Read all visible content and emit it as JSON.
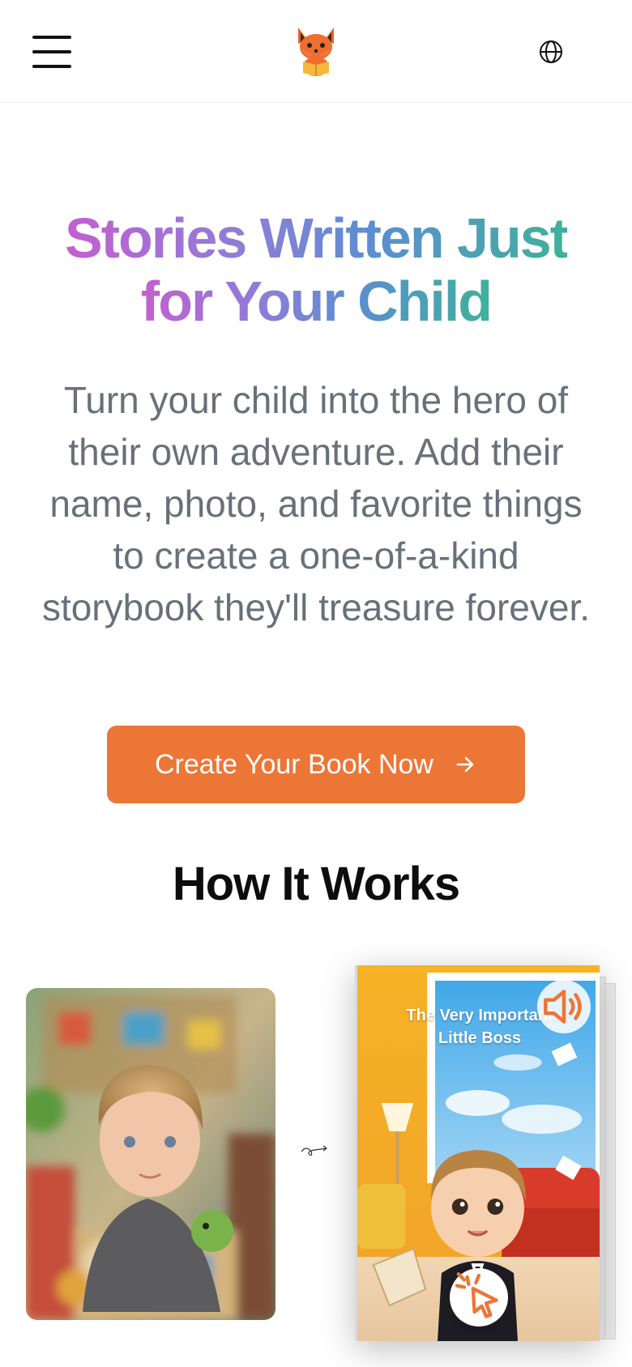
{
  "header": {
    "menu_icon": "hamburger-menu-icon",
    "logo_icon": "fox-reading-book-logo",
    "language_icon": "globe-icon"
  },
  "hero": {
    "title_line1": "Stories Written Just",
    "title_line2": "for Your Child",
    "subtitle": "Turn your child into the hero of their own adventure. Add their name, photo, and favorite things to create a one-of-a-kind storybook they'll treasure forever.",
    "cta_label": "Create Your Book Now",
    "cta_icon": "arrow-right-icon",
    "cta_color": "#ec7636"
  },
  "how_it_works": {
    "heading": "How It Works",
    "photo_icon": "child-photo",
    "arrow_icon": "curly-arrow-icon",
    "book": {
      "title": "The Very Important Little Boss",
      "audio_icon": "speaker-icon",
      "tap_icon": "tap-pointer-icon"
    }
  },
  "colors": {
    "gradient": [
      "#c45fd0",
      "#8d7ed8",
      "#5a8fd0",
      "#3fb19a"
    ],
    "subtitle": "#6b6f7a"
  }
}
